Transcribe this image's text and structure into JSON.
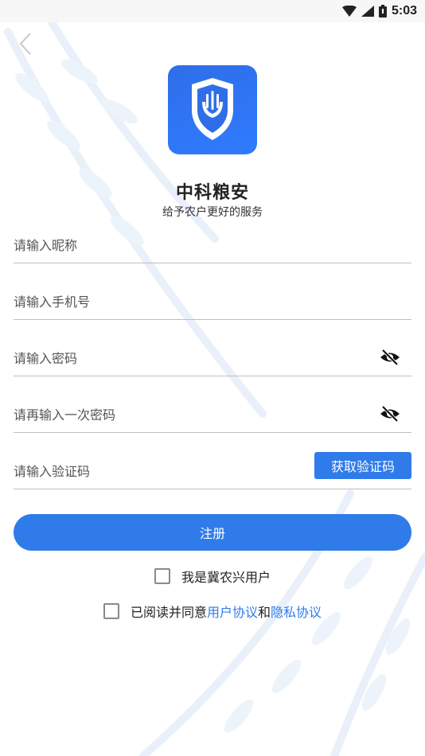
{
  "status_bar": {
    "time": "5:03"
  },
  "app": {
    "name": "中科粮安",
    "tagline": "给予农户更好的服务"
  },
  "form": {
    "nickname": {
      "placeholder": "请输入昵称",
      "value": ""
    },
    "phone": {
      "placeholder": "请输入手机号",
      "value": ""
    },
    "password": {
      "placeholder": "请输入密码",
      "value": ""
    },
    "confirm_password": {
      "placeholder": "请再输入一次密码",
      "value": ""
    },
    "verification_code": {
      "placeholder": "请输入验证码",
      "value": ""
    },
    "get_code_label": "获取验证码",
    "register_label": "注册"
  },
  "options": {
    "jinongxing_user_label": "我是冀农兴用户",
    "agreement_prefix": "已阅读并同意",
    "user_agreement_link": "用户协议",
    "and_text": "和",
    "privacy_link": "隐私协议"
  },
  "icons": [
    "wifi-icon",
    "signal-icon",
    "battery-icon",
    "back-arrow-icon",
    "app-logo-icon",
    "eye-off-icon"
  ],
  "colors": {
    "primary": "#2f7bea",
    "logo": "#2f6ee8",
    "text": "#333333",
    "divider": "#bfbfbf"
  }
}
